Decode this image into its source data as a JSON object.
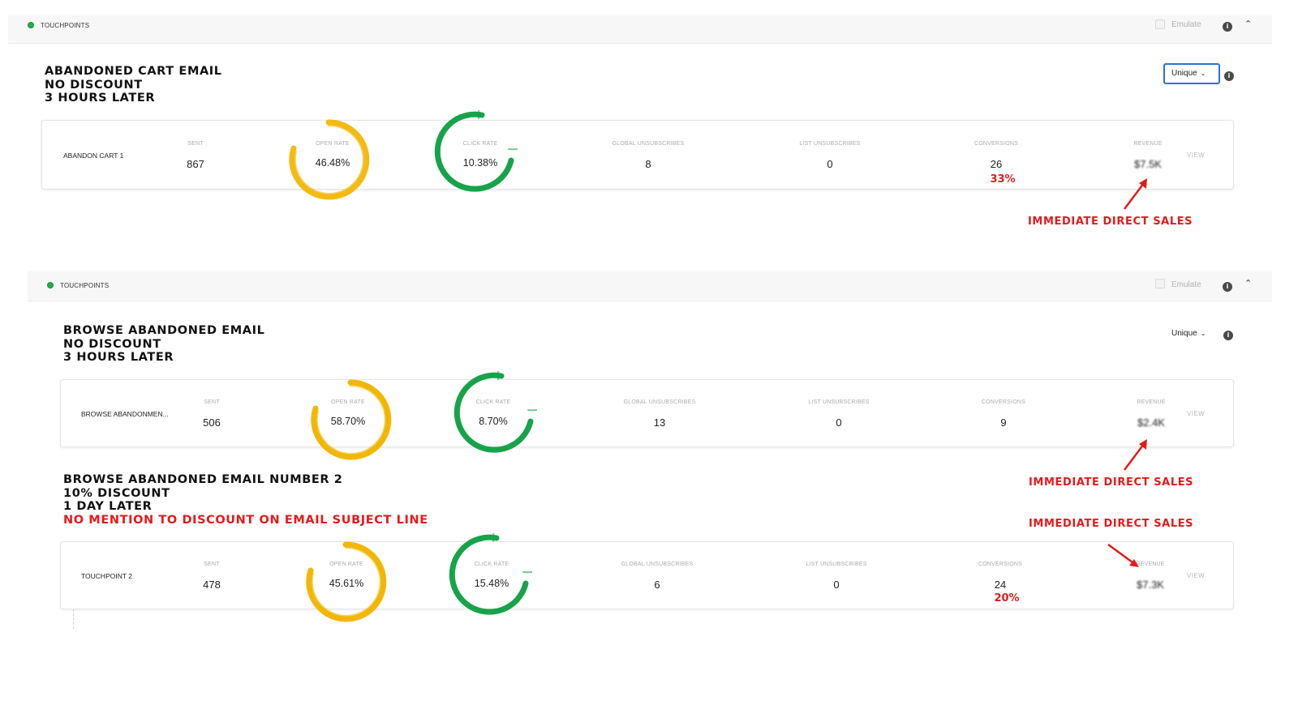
{
  "panels": [
    {
      "header": {
        "title": "TOUCHPOINTS",
        "emulate_label": "Emulate"
      },
      "title_lines": [
        "ABANDONED CART EMAIL",
        "NO DISCOUNT",
        "3 HOURS LATER"
      ],
      "select_value": "Unique"
    },
    {
      "header": {
        "title": "TOUCHPOINTS",
        "emulate_label": "Emulate"
      },
      "title_lines": [
        "BROWSE ABANDONED EMAIL",
        "NO DISCOUNT",
        "3 HOURS LATER"
      ],
      "select_value": "Unique",
      "second_title_lines": [
        "BROWSE ABANDONED EMAIL NUMBER 2",
        "10% DISCOUNT",
        "1 DAY LATER"
      ],
      "second_title_note": "NO MENTION TO DISCOUNT ON EMAIL SUBJECT LINE"
    }
  ],
  "labels": {
    "sent": "SENT",
    "open_rate": "OPEN RATE",
    "click_rate": "CLICK RATE",
    "global_unsubscribes": "GLOBAL UNSUBSCRIBES",
    "list_unsubscribes": "LIST UNSUBSCRIBES",
    "conversions": "CONVERSIONS",
    "revenue": "REVENUE",
    "view": "VIEW"
  },
  "rows": [
    {
      "name": "ABANDON CART 1",
      "sent": "867",
      "open_rate": "46.48%",
      "click_rate": "10.38%",
      "global_unsubscribes": "8",
      "list_unsubscribes": "0",
      "conversions": "26",
      "revenue": "$7.5K",
      "conversion_pct": "33%"
    },
    {
      "name": "BROWSE ABANDONMEN...",
      "sent": "506",
      "open_rate": "58.70%",
      "click_rate": "8.70%",
      "global_unsubscribes": "13",
      "list_unsubscribes": "0",
      "conversions": "9",
      "revenue": "$2.4K"
    },
    {
      "name": "TOUCHPOINT 2",
      "sent": "478",
      "open_rate": "45.61%",
      "click_rate": "15.48%",
      "global_unsubscribes": "6",
      "list_unsubscribes": "0",
      "conversions": "24",
      "revenue": "$7.3K",
      "conversion_pct": "20%"
    }
  ],
  "annotations": {
    "immediate_direct_sales": "IMMEDIATE DIRECT SALES"
  },
  "colors": {
    "open_rate_ring": "#f2b705",
    "click_rate_ring": "#17a34a",
    "annotation_red": "#e21b1b",
    "status_green": "#20b04b",
    "select_border": "#2f6fd6"
  },
  "icons": {
    "status": "status-dot-icon",
    "info": "info-icon",
    "collapse": "chevron-up-icon",
    "select": "chevron-down-icon",
    "arrow": "arrow-icon"
  }
}
